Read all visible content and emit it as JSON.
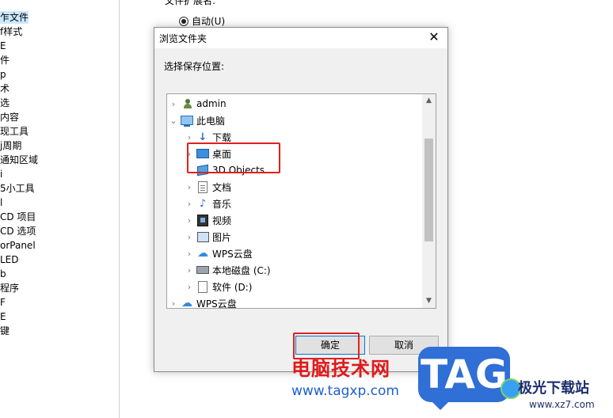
{
  "background": {
    "sidebar_items": [
      {
        "label": "乍文件",
        "selected": true
      },
      {
        "label": "f样式"
      },
      {
        "label": "E"
      },
      {
        "label": "件"
      },
      {
        "label": "p"
      },
      {
        "label": "术"
      },
      {
        "label": "选"
      },
      {
        "label": "内容"
      },
      {
        "label": "现工具"
      },
      {
        "label": "j周期"
      },
      {
        "label": "通知区域"
      },
      {
        "label": "i"
      },
      {
        "label": "5小工具"
      },
      {
        "label": "l"
      },
      {
        "label": "CD 项目"
      },
      {
        "label": "CD 选项"
      },
      {
        "label": "orPanel"
      },
      {
        "label": "LED"
      },
      {
        "label": "b"
      },
      {
        "label": "程序"
      },
      {
        "label": "F"
      },
      {
        "label": "E"
      },
      {
        "label": "键"
      }
    ],
    "ext_label": "文件扩展名:",
    "auto_option": "自动(U)"
  },
  "dialog": {
    "title": "浏览文件夹",
    "close_glyph": "✕",
    "prompt": "选择保存位置:",
    "tree": [
      {
        "label": "admin",
        "icon": "user-icon",
        "indent": 0,
        "chevron": "›"
      },
      {
        "label": "此电脑",
        "icon": "computer-icon",
        "indent": 0,
        "chevron": "⌄"
      },
      {
        "label": "下载",
        "icon": "download-icon",
        "indent": 1,
        "chevron": "›"
      },
      {
        "label": "桌面",
        "icon": "desktop-icon",
        "indent": 1,
        "chevron": "›",
        "selected": true
      },
      {
        "label": "3D Objects",
        "icon": "3d-objects-icon",
        "indent": 1,
        "chevron": ""
      },
      {
        "label": "文档",
        "icon": "document-icon",
        "indent": 1,
        "chevron": "›"
      },
      {
        "label": "音乐",
        "icon": "music-icon",
        "indent": 1,
        "chevron": "›"
      },
      {
        "label": "视频",
        "icon": "video-icon",
        "indent": 1,
        "chevron": "›"
      },
      {
        "label": "图片",
        "icon": "picture-icon",
        "indent": 1,
        "chevron": "›"
      },
      {
        "label": "WPS云盘",
        "icon": "cloud-icon",
        "indent": 1,
        "chevron": "›"
      },
      {
        "label": "本地磁盘 (C:)",
        "icon": "drive-icon",
        "indent": 1,
        "chevron": "›"
      },
      {
        "label": "软件 (D:)",
        "icon": "file-drive-icon",
        "indent": 1,
        "chevron": "›"
      },
      {
        "label": "WPS云盘",
        "icon": "cloud-icon",
        "indent": 0,
        "chevron": "›"
      }
    ],
    "ok_label": "确定",
    "cancel_label": "取消"
  },
  "watermark": {
    "line1": "电脑技术网",
    "line2": "www.tagxp.com",
    "tag": "TAG",
    "site_name": "极光下载站",
    "site_url": "www.xz7.com"
  },
  "colors": {
    "highlight": "#e02020",
    "selection": "#cce8ff",
    "watermark_red": "#e0191b",
    "watermark_blue": "#2f6fd6"
  }
}
